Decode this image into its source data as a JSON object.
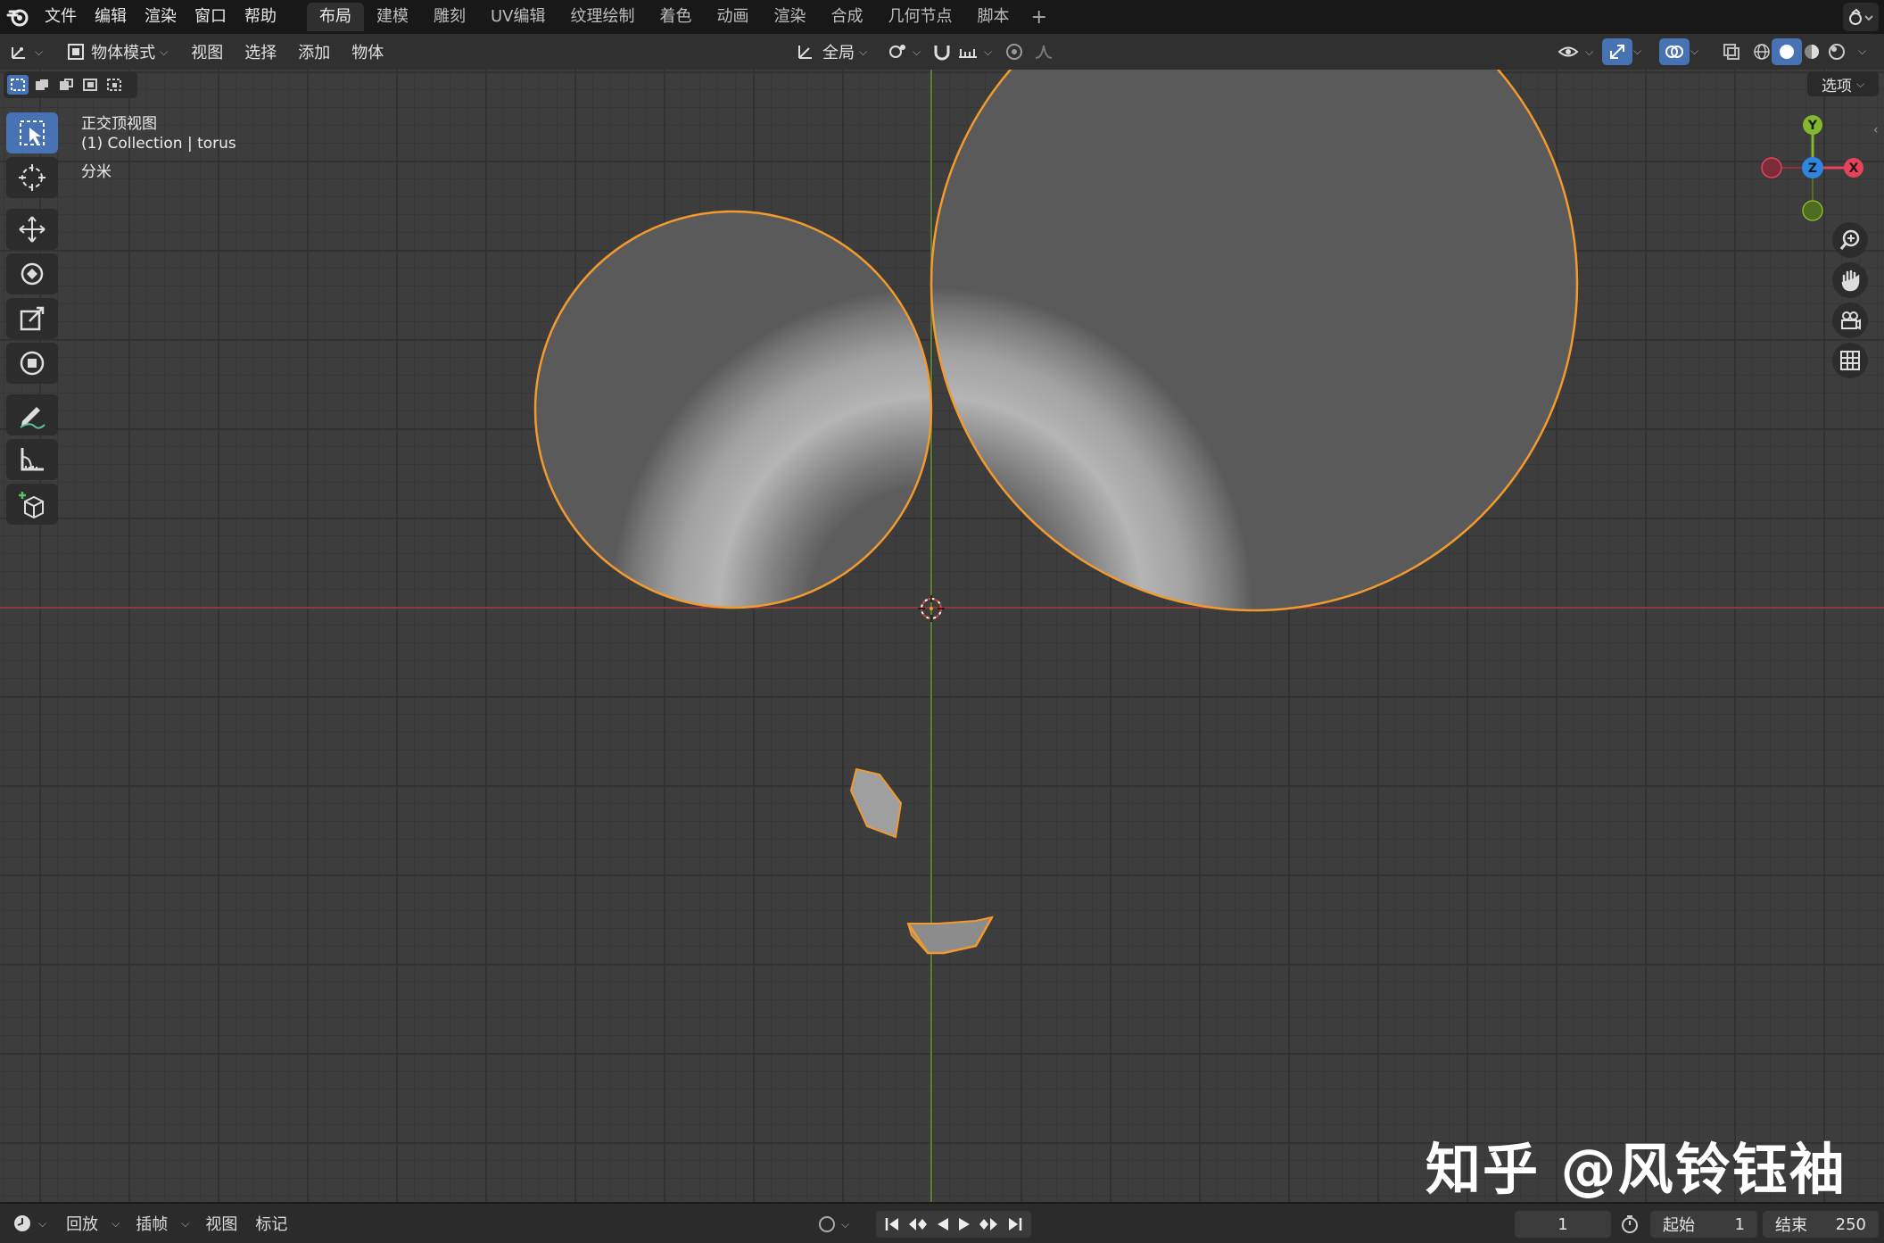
{
  "topbar": {
    "menus": [
      "文件",
      "编辑",
      "渲染",
      "窗口",
      "帮助"
    ],
    "workspaces": [
      "布局",
      "建模",
      "雕刻",
      "UV编辑",
      "纹理绘制",
      "着色",
      "动画",
      "渲染",
      "合成",
      "几何节点",
      "脚本"
    ],
    "active_workspace": "布局",
    "add_workspace": "+"
  },
  "header": {
    "mode": "物体模式",
    "menus": [
      "视图",
      "选择",
      "添加",
      "物体"
    ],
    "transform_orientation": "全局"
  },
  "viewport": {
    "view_name": "正交顶视图",
    "collection_info": "(1) Collection | torus",
    "units": "分米",
    "options_label": "选项",
    "gizmo": {
      "x": "X",
      "y": "Y",
      "z": "Z"
    },
    "colors": {
      "selection_outline": "#f29a2e",
      "x_axis": "#e8425a",
      "y_axis": "#84b82c",
      "z_axis": "#2f86e0",
      "active_tool": "#4772b3"
    }
  },
  "watermark": "知乎 @风铃钰袖",
  "timeline": {
    "menus": [
      "回放",
      "插帧",
      "视图",
      "标记"
    ],
    "current_frame": "1",
    "start_label": "起始",
    "start_value": "1",
    "end_label": "结束",
    "end_value": "250"
  }
}
